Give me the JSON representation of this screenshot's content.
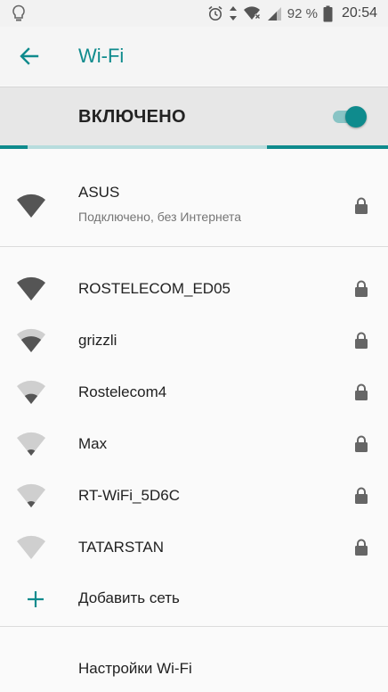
{
  "status_bar": {
    "left_icon": "lightbulb-icon",
    "icons": [
      "alarm-icon",
      "data-transfer-icon",
      "wifi-off-icon",
      "signal-icon",
      "battery-icon"
    ],
    "battery_text": "92 %",
    "time": "20:54"
  },
  "app_bar": {
    "back_icon": "arrow-back-icon",
    "title": "Wi-Fi"
  },
  "wifi_toggle": {
    "label": "ВКЛЮЧЕНО",
    "on": true
  },
  "connected_network": {
    "name": "ASUS",
    "status": "Подключено, без Интернета",
    "signal_bars": 4,
    "secured": true
  },
  "networks": [
    {
      "name": "ROSTELECOM_ED05",
      "signal_bars": 4,
      "secured": true
    },
    {
      "name": "grizzli",
      "signal_bars": 3,
      "secured": true
    },
    {
      "name": "Rostelecom4",
      "signal_bars": 2,
      "secured": true
    },
    {
      "name": "Max",
      "signal_bars": 1,
      "secured": true
    },
    {
      "name": "RT-WiFi_5D6C",
      "signal_bars": 1,
      "secured": true
    },
    {
      "name": "TATARSTAN",
      "signal_bars": 0,
      "secured": true
    }
  ],
  "add_network": {
    "icon": "plus-icon",
    "label": "Добавить сеть"
  },
  "wifi_settings": {
    "label": "Настройки Wi-Fi"
  },
  "colors": {
    "accent": "#0f8b8d",
    "wifi_dark": "#555555",
    "wifi_light": "#cfcfcf"
  }
}
